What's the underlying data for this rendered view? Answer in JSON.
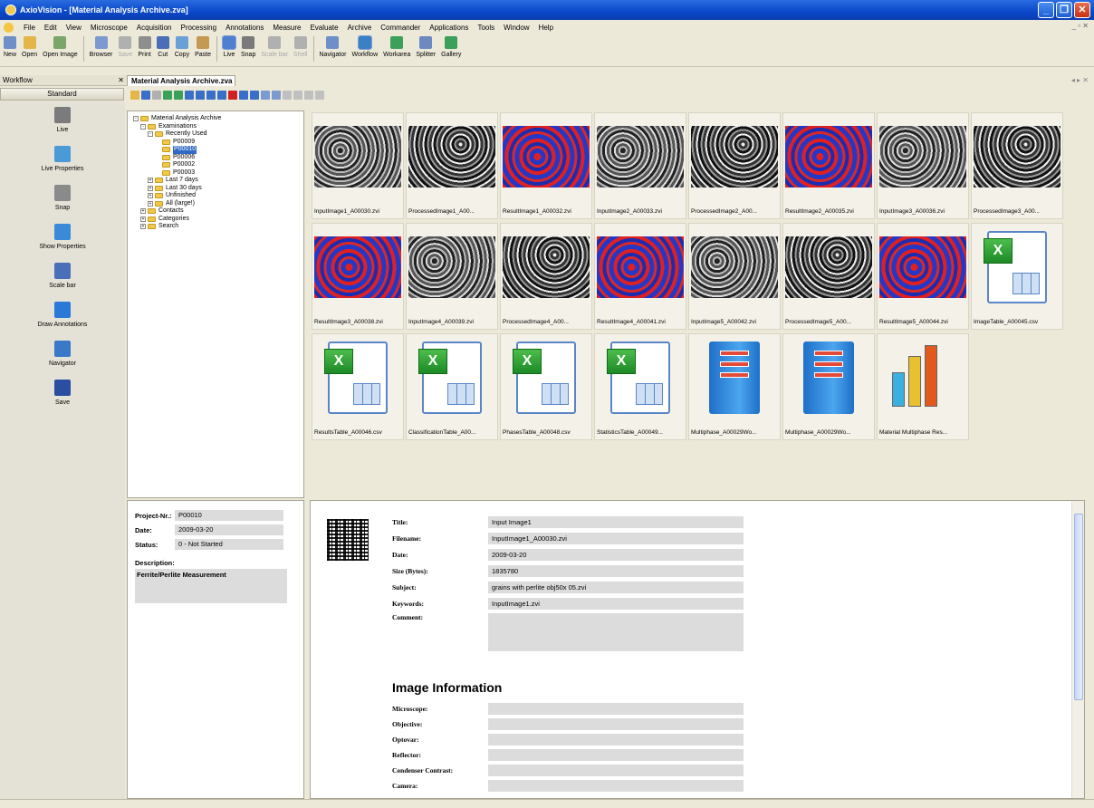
{
  "window": {
    "title": "AxioVision - [Material Analysis Archive.zva]"
  },
  "menu": [
    "File",
    "Edit",
    "View",
    "Microscope",
    "Acquisition",
    "Processing",
    "Annotations",
    "Measure",
    "Evaluate",
    "Archive",
    "Commander",
    "Applications",
    "Tools",
    "Window",
    "Help"
  ],
  "toolbar": [
    "New",
    "Open",
    "Open Image",
    "Browser",
    "Save",
    "Print",
    "Cut",
    "Copy",
    "Paste",
    "Live",
    "Snap",
    "Scale bar",
    "Shell",
    "Navigator",
    "Workflow",
    "Workarea",
    "Splitter",
    "Gallery"
  ],
  "workflow_panel": {
    "header": "Workflow",
    "caption": "Standard",
    "items": [
      "Live",
      "Live Properties",
      "Snap",
      "Show Properties",
      "Scale bar",
      "Draw Annotations",
      "Navigator",
      "Save"
    ]
  },
  "document_tab": "Material Analysis Archive.zva",
  "tree": [
    {
      "label": "Material Analysis Archive",
      "level": 0,
      "exp": "-"
    },
    {
      "label": "Examinations",
      "level": 1,
      "exp": "-"
    },
    {
      "label": "Recently Used",
      "level": 2,
      "exp": "-"
    },
    {
      "label": "P00009",
      "level": 3,
      "exp": ""
    },
    {
      "label": "P00010",
      "level": 3,
      "exp": "",
      "selected": true
    },
    {
      "label": "P00006",
      "level": 3,
      "exp": ""
    },
    {
      "label": "P00002",
      "level": 3,
      "exp": ""
    },
    {
      "label": "P00003",
      "level": 3,
      "exp": ""
    },
    {
      "label": "Last 7 days",
      "level": 2,
      "exp": "+"
    },
    {
      "label": "Last 30 days",
      "level": 2,
      "exp": "+"
    },
    {
      "label": "Unfinished",
      "level": 2,
      "exp": "+"
    },
    {
      "label": "All (large!)",
      "level": 2,
      "exp": "+"
    },
    {
      "label": "Contacts",
      "level": 1,
      "exp": "+"
    },
    {
      "label": "Categories",
      "level": 1,
      "exp": "+"
    },
    {
      "label": "Search",
      "level": 1,
      "exp": "+"
    }
  ],
  "gallery": [
    {
      "caption": "InputImage1_A00030.zvi",
      "kind": "micro"
    },
    {
      "caption": "ProcessedImage1_A00...",
      "kind": "microb"
    },
    {
      "caption": "ResultImage1_A00032.zvi",
      "kind": "phase"
    },
    {
      "caption": "InputImage2_A00033.zvi",
      "kind": "micro"
    },
    {
      "caption": "ProcessedImage2_A00...",
      "kind": "microb"
    },
    {
      "caption": "ResultImage2_A00035.zvi",
      "kind": "phase"
    },
    {
      "caption": "InputImage3_A00036.zvi",
      "kind": "micro"
    },
    {
      "caption": "ProcessedImage3_A00...",
      "kind": "microb"
    },
    {
      "caption": "ResultImage3_A00038.zvi",
      "kind": "phase"
    },
    {
      "caption": "InputImage4_A00039.zvi",
      "kind": "micro"
    },
    {
      "caption": "ProcessedImage4_A00...",
      "kind": "microb"
    },
    {
      "caption": "ResultImage4_A00041.zvi",
      "kind": "phase"
    },
    {
      "caption": "InputImage5_A00042.zvi",
      "kind": "micro"
    },
    {
      "caption": "ProcessedImage5_A00...",
      "kind": "microb"
    },
    {
      "caption": "ResultImage5_A00044.zvi",
      "kind": "phase"
    },
    {
      "caption": "ImageTable_A00045.csv",
      "kind": "xl"
    },
    {
      "caption": "ResultsTable_A00046.csv",
      "kind": "xl"
    },
    {
      "caption": "ClassificationTable_A00...",
      "kind": "xl"
    },
    {
      "caption": "PhasesTable_A00048.csv",
      "kind": "xl"
    },
    {
      "caption": "StatisticsTable_A00049...",
      "kind": "xl"
    },
    {
      "caption": "Multiphase_A00029Wo...",
      "kind": "rep"
    },
    {
      "caption": "Multiphase_A00029Wo...",
      "kind": "rep"
    },
    {
      "caption": "Material Multiphase Res...",
      "kind": "chart"
    }
  ],
  "project": {
    "project_label": "Project-Nr.:",
    "project_value": "P00010",
    "date_label": "Date:",
    "date_value": "2009-03-20",
    "status_label": "Status:",
    "status_value": "0 - Not Started",
    "description_label": "Description:",
    "description_value": "Ferrite/Perlite Measurement"
  },
  "details": {
    "rows": [
      {
        "label": "Title:",
        "value": "Input Image1"
      },
      {
        "label": "Filename:",
        "value": "InputImage1_A00030.zvi"
      },
      {
        "label": "Date:",
        "value": "2009-03-20"
      },
      {
        "label": "Size (Bytes):",
        "value": "1835780"
      },
      {
        "label": "Subject:",
        "value": "grains with perlite obj50x 05.zvi"
      },
      {
        "label": "Keywords:",
        "value": "InputImage1.zvi"
      },
      {
        "label": "Comment:",
        "value": ""
      }
    ],
    "image_info_heading": "Image Information",
    "image_rows": [
      "Microscope:",
      "Objective:",
      "Optovar:",
      "Reflector:",
      "Condenser Contrast:",
      "Camera:"
    ]
  }
}
